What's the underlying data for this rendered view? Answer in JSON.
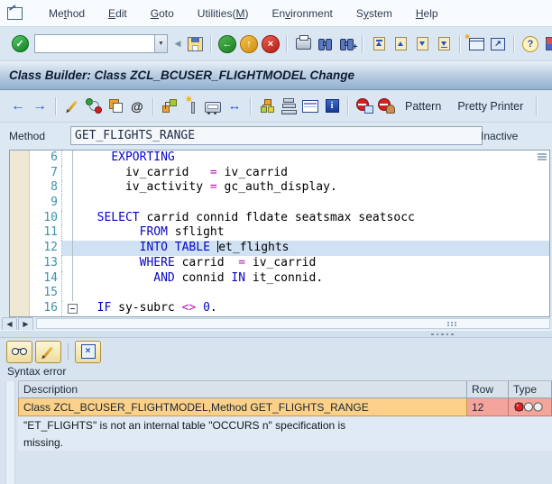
{
  "menu": {
    "items": [
      {
        "pre": "Me",
        "key": "t",
        "post": "hod"
      },
      {
        "pre": "",
        "key": "E",
        "post": "dit"
      },
      {
        "pre": "",
        "key": "G",
        "post": "oto"
      },
      {
        "pre": "Utilities(",
        "key": "M",
        "post": ")"
      },
      {
        "pre": "En",
        "key": "v",
        "post": "ironment"
      },
      {
        "pre": "S",
        "key": "y",
        "post": "stem"
      },
      {
        "pre": "",
        "key": "H",
        "post": "elp"
      }
    ]
  },
  "glyphs": {
    "check": "✓",
    "dropdown": "▼",
    "collapse": "◀",
    "back": "←",
    "up": "↑",
    "cross": "×",
    "at": "@",
    "swap": "↔",
    "ne_arrow": "↗",
    "question": "?",
    "left": "←",
    "right": "→",
    "tri_left": "◀",
    "tri_right": "▶",
    "info": "i",
    "plus": "+",
    "star": "*"
  },
  "system_toolbar": {
    "command_value": ""
  },
  "titlebar": {
    "title": "Class Builder: Class ZCL_BCUSER_FLIGHTMODEL Change"
  },
  "app_toolbar": {
    "pattern": "Pattern",
    "pretty_printer": "Pretty Printer"
  },
  "method_bar": {
    "label": "Method",
    "value": "GET_FLIGHTS_RANGE",
    "status": "Inactive"
  },
  "editor": {
    "lines": [
      {
        "n": "6",
        "fold": "line",
        "t": [
          [
            "    ",
            "p"
          ],
          [
            "EXPORTING",
            "k"
          ]
        ]
      },
      {
        "n": "7",
        "fold": "line",
        "t": [
          [
            "      ",
            "p"
          ],
          [
            "iv_carrid",
            "i"
          ],
          [
            "   ",
            "p"
          ],
          [
            "=",
            "o"
          ],
          [
            " ",
            "p"
          ],
          [
            "iv_carrid",
            "i"
          ]
        ]
      },
      {
        "n": "8",
        "fold": "line",
        "t": [
          [
            "      ",
            "p"
          ],
          [
            "iv_activity",
            "i"
          ],
          [
            " ",
            "p"
          ],
          [
            "=",
            "o"
          ],
          [
            " ",
            "p"
          ],
          [
            "gc_auth_display",
            "i"
          ],
          [
            ".",
            "i"
          ]
        ]
      },
      {
        "n": "9",
        "fold": "line",
        "t": []
      },
      {
        "n": "10",
        "fold": "line",
        "t": [
          [
            "  ",
            "p"
          ],
          [
            "SELECT",
            "k"
          ],
          [
            " ",
            "p"
          ],
          [
            "carrid connid fldate seatsmax seatsocc",
            "i"
          ]
        ]
      },
      {
        "n": "11",
        "fold": "line",
        "t": [
          [
            "        ",
            "p"
          ],
          [
            "FROM",
            "k"
          ],
          [
            " ",
            "p"
          ],
          [
            "sflight",
            "i"
          ]
        ]
      },
      {
        "n": "12",
        "fold": "line",
        "hl": true,
        "t": [
          [
            "        ",
            "p"
          ],
          [
            "INTO",
            "k"
          ],
          [
            " ",
            "p"
          ],
          [
            "TABLE",
            "k"
          ],
          [
            " ",
            "p"
          ],
          [
            "",
            "c"
          ],
          [
            "et_flights",
            "i"
          ]
        ]
      },
      {
        "n": "13",
        "fold": "line",
        "t": [
          [
            "        ",
            "p"
          ],
          [
            "WHERE",
            "k"
          ],
          [
            " ",
            "p"
          ],
          [
            "carrid",
            "i"
          ],
          [
            "  ",
            "p"
          ],
          [
            "=",
            "o"
          ],
          [
            " ",
            "p"
          ],
          [
            "iv_carrid",
            "i"
          ]
        ]
      },
      {
        "n": "14",
        "fold": "line",
        "t": [
          [
            "          ",
            "p"
          ],
          [
            "AND",
            "k"
          ],
          [
            " ",
            "p"
          ],
          [
            "connid",
            "i"
          ],
          [
            " ",
            "p"
          ],
          [
            "IN",
            "k"
          ],
          [
            " ",
            "p"
          ],
          [
            "it_connid",
            "i"
          ],
          [
            ".",
            "i"
          ]
        ]
      },
      {
        "n": "15",
        "fold": "line",
        "t": []
      },
      {
        "n": "16",
        "fold": "box",
        "t": [
          [
            "  ",
            "p"
          ],
          [
            "IF",
            "k"
          ],
          [
            " ",
            "p"
          ],
          [
            "sy-subrc",
            "i"
          ],
          [
            " ",
            "p"
          ],
          [
            "<>",
            "o"
          ],
          [
            " ",
            "p"
          ],
          [
            "0",
            "n"
          ],
          [
            ".",
            "i"
          ]
        ]
      }
    ]
  },
  "panel": {
    "title": "Syntax error",
    "table": {
      "headers": [
        "Description",
        "Row",
        "Type"
      ],
      "error_row": {
        "description": "Class ZCL_BCUSER_FLIGHTMODEL,Method GET_FLIGHTS_RANGE",
        "row": "12"
      },
      "message_lines": [
        "\"ET_FLIGHTS\" is not an internal table \"OCCURS n\" specification is",
        "missing."
      ]
    }
  },
  "colors": {
    "keyword": "#0606c4",
    "operator": "#b513b5",
    "number": "#0606c4",
    "line_number": "#3d92ad",
    "highlight_line": "#cfe1f3",
    "error_desc_bg": "#fbd088",
    "error_cell_bg": "#f5a49b",
    "titlebar_gradient_bottom": "#8fb0d0",
    "background": "#dce8f2"
  },
  "icons": {
    "enter-icon": "green check ball",
    "command-dropdown-icon": "▼",
    "collapse-icon": "◀",
    "save-icon": "floppy",
    "back-icon": "green ←",
    "exit-icon": "amber ↑",
    "cancel-icon": "red ×",
    "print-icon": "printer",
    "find-icon": "binoculars",
    "find-next-icon": "binoculars plus",
    "first-page-icon": "page up bar",
    "previous-page-icon": "page up",
    "next-page-icon": "page down",
    "last-page-icon": "page down bar",
    "new-session-icon": "window star",
    "shortcut-icon": "window ↗",
    "help-icon": "?",
    "customize-layout-icon": "color grid",
    "back-nav-icon": "←",
    "forward-nav-icon": "→",
    "display-change-icon": "pencil",
    "syntax-check-icon": "ring green red",
    "activate-icon": "stacked squares",
    "where-used-icon": "@",
    "navigation-icon": "linked squares",
    "test-icon": "magic wand",
    "runtime-analysis-icon": "carriage",
    "goto-icon": "↔",
    "class-hierarchy-icon": "org chart",
    "inheritance-icon": "layers",
    "method-list-icon": "table",
    "documentation-icon": "blue i",
    "breakpoint-icon": "stop window",
    "external-breakpoint-icon": "stop person",
    "display-view-icon": "glasses",
    "edit-view-icon": "pencil",
    "close-panel-icon": "blue ×",
    "error-status-icon": "red traffic light"
  }
}
